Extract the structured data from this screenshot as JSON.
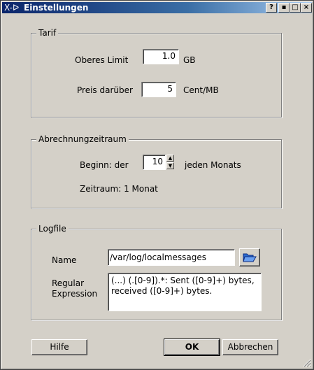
{
  "window": {
    "title": "Einstellungen",
    "title_icon": "X-ᐅ"
  },
  "titlebar_buttons": [
    "?",
    "▪",
    "□",
    "×"
  ],
  "tarif": {
    "legend": "Tarif",
    "limit_label": "Oberes Limit",
    "limit_value": "1.0",
    "limit_unit": "GB",
    "price_label": "Preis darüber",
    "price_value": "5",
    "price_unit": "Cent/MB"
  },
  "abrechnung": {
    "legend": "Abrechnungzeitraum",
    "begin_label": "Beginn: der",
    "begin_value": "10",
    "begin_suffix": "jeden Monats",
    "period_text": "Zeitraum: 1 Monat"
  },
  "logfile": {
    "legend": "Logfile",
    "name_label": "Name",
    "name_value": "/var/log/localmessages",
    "regex_label_1": "Regular",
    "regex_label_2": "Expression",
    "regex_value": "(...) (.[0-9]).*: Sent ([0-9]+) bytes,\nreceived ([0-9]+) bytes."
  },
  "buttons": {
    "help": "Hilfe",
    "ok": "OK",
    "cancel": "Abbrechen"
  },
  "icons": {
    "browse": "folder-open-icon"
  }
}
